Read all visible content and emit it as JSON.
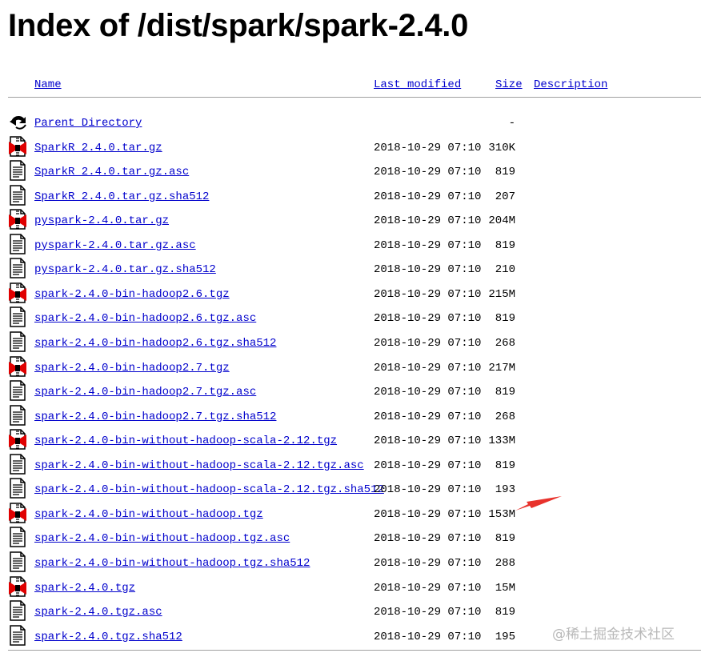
{
  "page": {
    "title": "Index of /dist/spark/spark-2.4.0"
  },
  "columns": {
    "name": "Name",
    "last_modified": "Last modified",
    "size": "Size",
    "description": "Description"
  },
  "rows": [
    {
      "name": "Parent Directory",
      "date": "",
      "size": "-",
      "icon": "back-icon"
    },
    {
      "name": "SparkR_2.4.0.tar.gz",
      "date": "2018-10-29 07:10",
      "size": "310K",
      "icon": "compressed-file-icon"
    },
    {
      "name": "SparkR_2.4.0.tar.gz.asc",
      "date": "2018-10-29 07:10",
      "size": "819",
      "icon": "text-file-icon"
    },
    {
      "name": "SparkR_2.4.0.tar.gz.sha512",
      "date": "2018-10-29 07:10",
      "size": "207",
      "icon": "text-file-icon"
    },
    {
      "name": "pyspark-2.4.0.tar.gz",
      "date": "2018-10-29 07:10",
      "size": "204M",
      "icon": "compressed-file-icon"
    },
    {
      "name": "pyspark-2.4.0.tar.gz.asc",
      "date": "2018-10-29 07:10",
      "size": "819",
      "icon": "text-file-icon"
    },
    {
      "name": "pyspark-2.4.0.tar.gz.sha512",
      "date": "2018-10-29 07:10",
      "size": "210",
      "icon": "text-file-icon"
    },
    {
      "name": "spark-2.4.0-bin-hadoop2.6.tgz",
      "date": "2018-10-29 07:10",
      "size": "215M",
      "icon": "compressed-file-icon"
    },
    {
      "name": "spark-2.4.0-bin-hadoop2.6.tgz.asc",
      "date": "2018-10-29 07:10",
      "size": "819",
      "icon": "text-file-icon"
    },
    {
      "name": "spark-2.4.0-bin-hadoop2.6.tgz.sha512",
      "date": "2018-10-29 07:10",
      "size": "268",
      "icon": "text-file-icon"
    },
    {
      "name": "spark-2.4.0-bin-hadoop2.7.tgz",
      "date": "2018-10-29 07:10",
      "size": "217M",
      "icon": "compressed-file-icon"
    },
    {
      "name": "spark-2.4.0-bin-hadoop2.7.tgz.asc",
      "date": "2018-10-29 07:10",
      "size": "819",
      "icon": "text-file-icon"
    },
    {
      "name": "spark-2.4.0-bin-hadoop2.7.tgz.sha512",
      "date": "2018-10-29 07:10",
      "size": "268",
      "icon": "text-file-icon"
    },
    {
      "name": "spark-2.4.0-bin-without-hadoop-scala-2.12.tgz",
      "date": "2018-10-29 07:10",
      "size": "133M",
      "icon": "compressed-file-icon"
    },
    {
      "name": "spark-2.4.0-bin-without-hadoop-scala-2.12.tgz.asc",
      "date": "2018-10-29 07:10",
      "size": "819",
      "icon": "text-file-icon"
    },
    {
      "name": "spark-2.4.0-bin-without-hadoop-scala-2.12.tgz.sha512",
      "date": "2018-10-29 07:10",
      "size": "193",
      "icon": "text-file-icon"
    },
    {
      "name": "spark-2.4.0-bin-without-hadoop.tgz",
      "date": "2018-10-29 07:10",
      "size": "153M",
      "icon": "compressed-file-icon"
    },
    {
      "name": "spark-2.4.0-bin-without-hadoop.tgz.asc",
      "date": "2018-10-29 07:10",
      "size": "819",
      "icon": "text-file-icon"
    },
    {
      "name": "spark-2.4.0-bin-without-hadoop.tgz.sha512",
      "date": "2018-10-29 07:10",
      "size": "288",
      "icon": "text-file-icon"
    },
    {
      "name": "spark-2.4.0.tgz",
      "date": "2018-10-29 07:10",
      "size": "15M",
      "icon": "compressed-file-icon"
    },
    {
      "name": "spark-2.4.0.tgz.asc",
      "date": "2018-10-29 07:10",
      "size": "819",
      "icon": "text-file-icon"
    },
    {
      "name": "spark-2.4.0.tgz.sha512",
      "date": "2018-10-29 07:10",
      "size": "195",
      "icon": "text-file-icon"
    }
  ],
  "annotation": {
    "icon": "red-arrow-icon",
    "color": "#e8322c"
  },
  "watermark": "@稀土掘金技术社区"
}
